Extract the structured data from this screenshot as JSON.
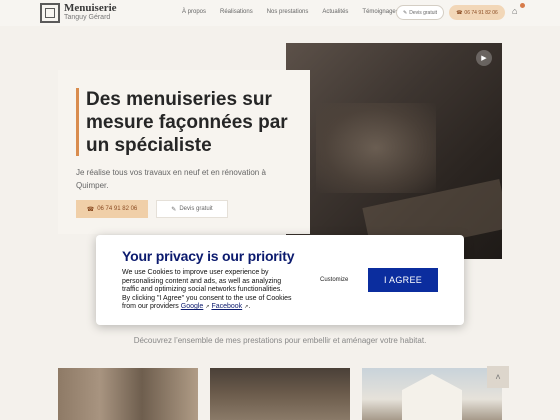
{
  "header": {
    "logo_title": "Menuiserie",
    "logo_sub": "Tanguy Gérard",
    "nav": [
      "À propos",
      "Réalisations",
      "Nos prestations",
      "Actualités",
      "Témoignages"
    ],
    "estimate_label": "Devis gratuit",
    "phone_label": "06 74 91 82 06"
  },
  "hero": {
    "title": "Des menuiseries sur mesure façonnées par un spécialiste",
    "description": "Je réalise tous vos travaux en neuf et en rénovation à Quimper.",
    "phone_button": "06 74 91 82 06",
    "estimate_button": "Devis gratuit"
  },
  "discover_text": "Découvrez l’ensemble de mes prestations pour embellir et aménager votre habitat.",
  "cookie": {
    "title": "Your privacy is our priority",
    "text_before": "We use Cookies to improve user experience by personalising content and ads, as well as analyzing traffic and optimizing social networks functionalities. By clicking \"I Agree\" you consent to the use of Cookies from our providers ",
    "link_google": "Google",
    "link_facebook": "Facebook",
    "customize_label": "Customize",
    "agree_label": "I AGREE"
  },
  "colors": {
    "accent": "#d98c4e",
    "modal_blue": "#0b2d9e",
    "title_blue": "#0b1a6e"
  }
}
